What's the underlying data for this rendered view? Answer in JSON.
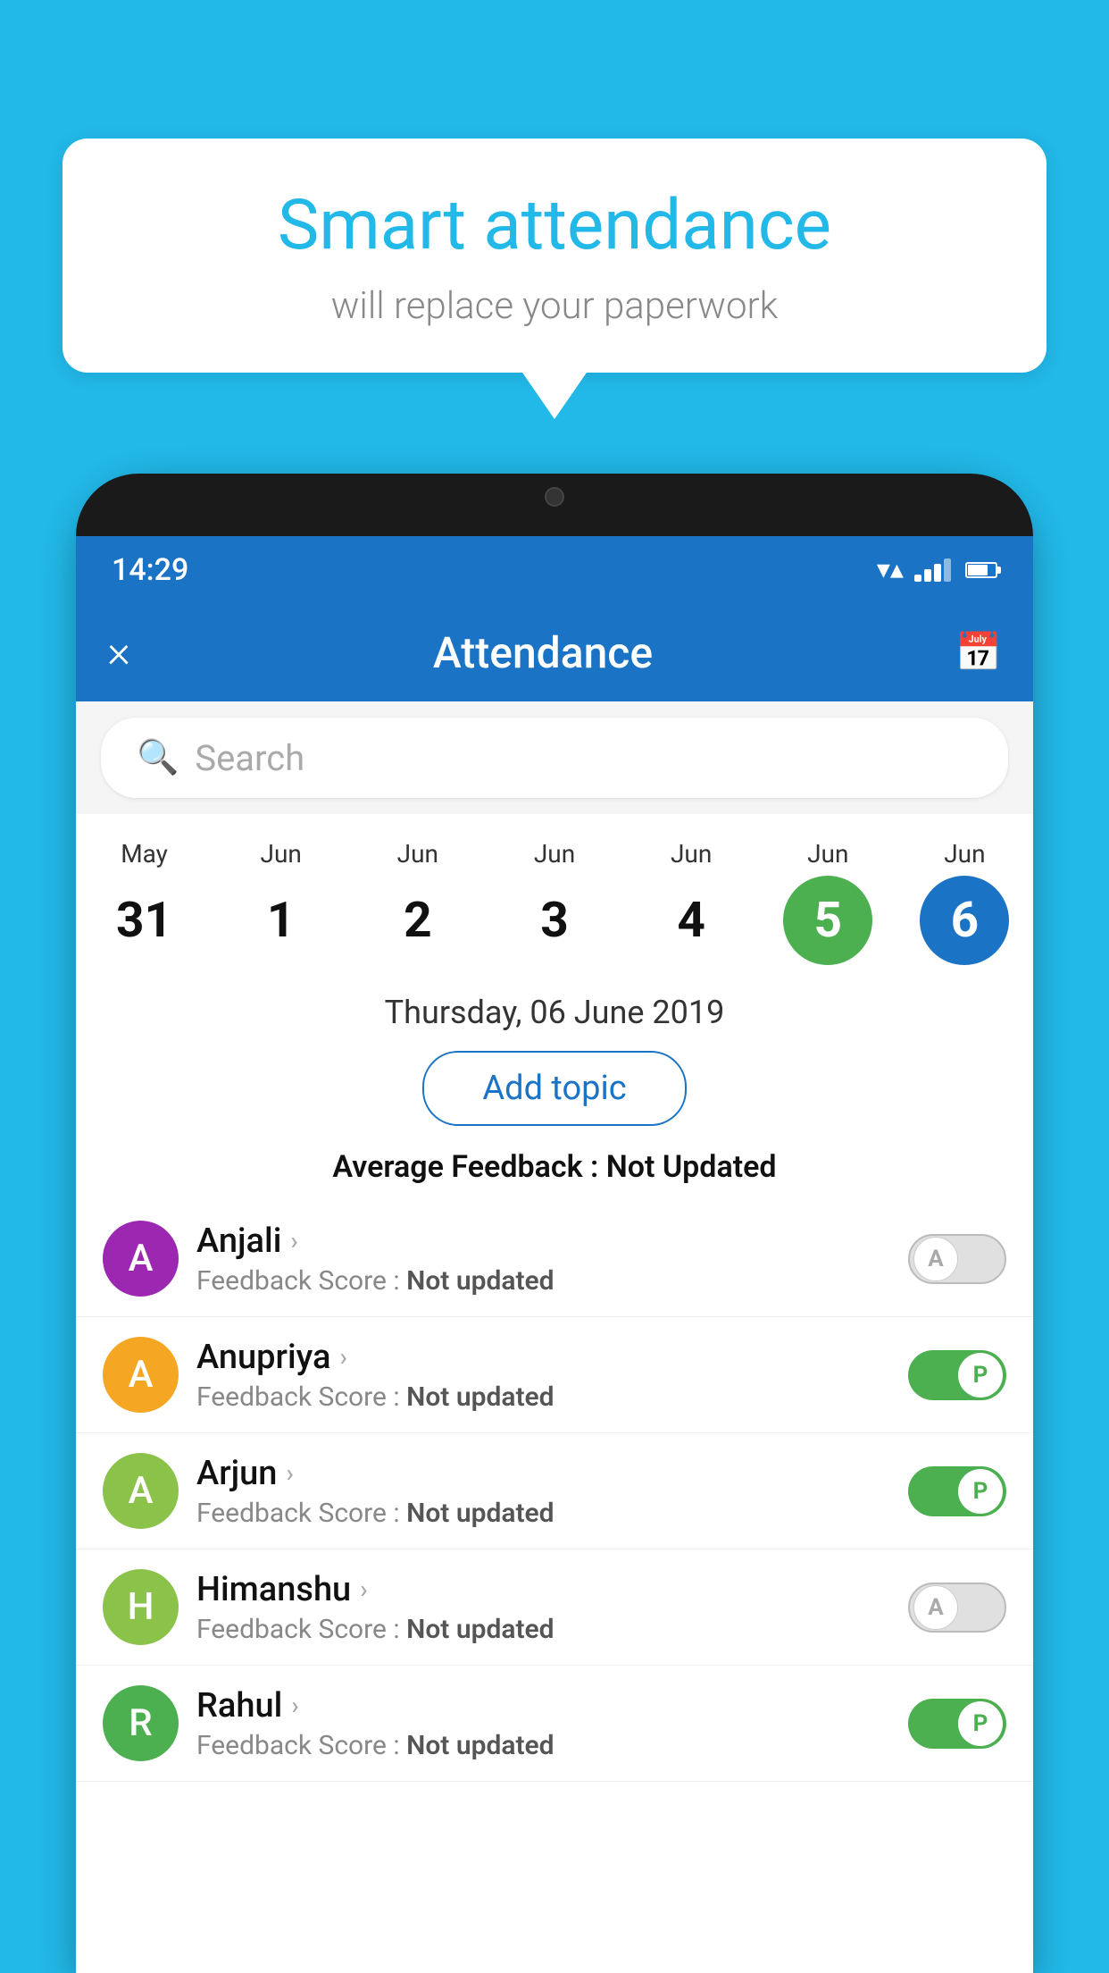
{
  "background_color": "#22b8e8",
  "speech_bubble": {
    "title": "Smart attendance",
    "subtitle": "will replace your paperwork"
  },
  "status_bar": {
    "time": "14:29"
  },
  "header": {
    "title": "Attendance",
    "close_label": "×",
    "calendar_icon": "calendar-icon"
  },
  "search": {
    "placeholder": "Search"
  },
  "dates": [
    {
      "month": "May",
      "day": "31",
      "state": "normal"
    },
    {
      "month": "Jun",
      "day": "1",
      "state": "normal"
    },
    {
      "month": "Jun",
      "day": "2",
      "state": "normal"
    },
    {
      "month": "Jun",
      "day": "3",
      "state": "normal"
    },
    {
      "month": "Jun",
      "day": "4",
      "state": "normal"
    },
    {
      "month": "Jun",
      "day": "5",
      "state": "today"
    },
    {
      "month": "Jun",
      "day": "6",
      "state": "selected"
    }
  ],
  "selected_date_label": "Thursday, 06 June 2019",
  "add_topic_label": "Add topic",
  "avg_feedback_label": "Average Feedback :",
  "avg_feedback_value": "Not Updated",
  "students": [
    {
      "name": "Anjali",
      "avatar_letter": "A",
      "avatar_color": "#9c27b0",
      "feedback_label": "Feedback Score :",
      "feedback_value": "Not updated",
      "attendance": "absent"
    },
    {
      "name": "Anupriya",
      "avatar_letter": "A",
      "avatar_color": "#f5a623",
      "feedback_label": "Feedback Score :",
      "feedback_value": "Not updated",
      "attendance": "present"
    },
    {
      "name": "Arjun",
      "avatar_letter": "A",
      "avatar_color": "#8bc34a",
      "feedback_label": "Feedback Score :",
      "feedback_value": "Not updated",
      "attendance": "present"
    },
    {
      "name": "Himanshu",
      "avatar_letter": "H",
      "avatar_color": "#8bc34a",
      "feedback_label": "Feedback Score :",
      "feedback_value": "Not updated",
      "attendance": "absent"
    },
    {
      "name": "Rahul",
      "avatar_letter": "R",
      "avatar_color": "#4caf50",
      "feedback_label": "Feedback Score :",
      "feedback_value": "Not updated",
      "attendance": "present"
    }
  ]
}
